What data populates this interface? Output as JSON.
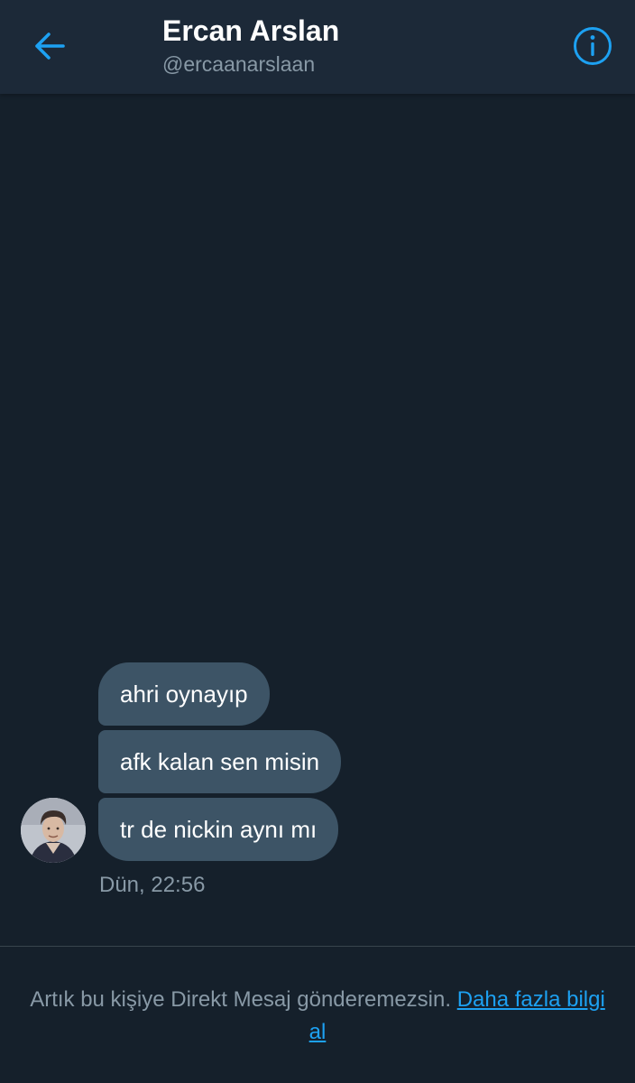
{
  "header": {
    "name": "Ercan Arslan",
    "handle": "@ercaanarslaan",
    "back_icon": "arrow-left-icon",
    "info_icon": "info-circle-icon"
  },
  "messages": [
    {
      "text": "ahri oynayıp"
    },
    {
      "text": "afk kalan sen misin"
    },
    {
      "text": "tr de nickin aynı mı"
    }
  ],
  "timestamp": "Dün, 22:56",
  "footer": {
    "notice": "Artık bu kişiye Direkt Mesaj gönderemezsin.",
    "link": "Daha fazla bilgi al"
  },
  "colors": {
    "background": "#15202b",
    "header": "#1c2938",
    "bubble": "#3d5466",
    "accent": "#1da1f2",
    "secondary_text": "#8899a6"
  }
}
